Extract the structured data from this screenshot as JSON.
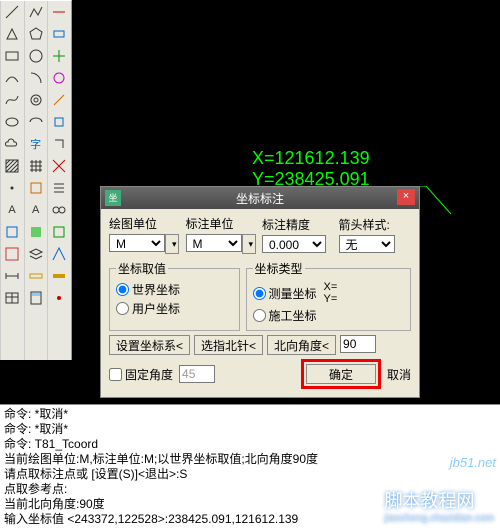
{
  "canvas": {
    "coord_x_label": "X=121612.139",
    "coord_y_label": "Y=238425.091",
    "axis_x": "X",
    "axis_y": "Y"
  },
  "dialog": {
    "title": "坐标标注",
    "close": "×",
    "labels": {
      "draw_unit": "绘图单位",
      "ann_unit": "标注单位",
      "precision": "标注精度",
      "arrow": "箭头样式:"
    },
    "fields": {
      "draw_unit": "M",
      "ann_unit": "M",
      "precision": "0.000",
      "arrow": "无"
    },
    "coord_src": {
      "legend": "坐标取值",
      "world": "世界坐标",
      "user": "用户坐标"
    },
    "coord_type": {
      "legend": "坐标类型",
      "survey": "测量坐标",
      "construct": "施工坐标",
      "survey_extra": "X=\nY=",
      "construct_extra": ""
    },
    "buttons": {
      "set_cs": "设置坐标系<",
      "pick_north": "选指北针<",
      "north_angle": "北向角度<",
      "north_value": "90",
      "fixed_angle": "固定角度",
      "fixed_value": "45",
      "ok": "确定",
      "cancel": "取消"
    }
  },
  "cmd": {
    "l1": "命令: *取消*",
    "l2": "命令: *取消*",
    "l3": "命令: T81_Tcoord",
    "l4": "当前绘图单位:M,标注单位:M;以世界坐标取值;北向角度90度",
    "l5": "请点取标注点或 [设置(S)]<退出>:S",
    "l6": "点取参考点:",
    "l7": "当前北向角度:90度",
    "l8": "输入坐标值 <243372,122528>:238425.091,121612.139"
  },
  "watermark": {
    "main": "脚本教程网",
    "sub": "jiaocheng.chazidian.com",
    "corner": "jb51.net"
  }
}
